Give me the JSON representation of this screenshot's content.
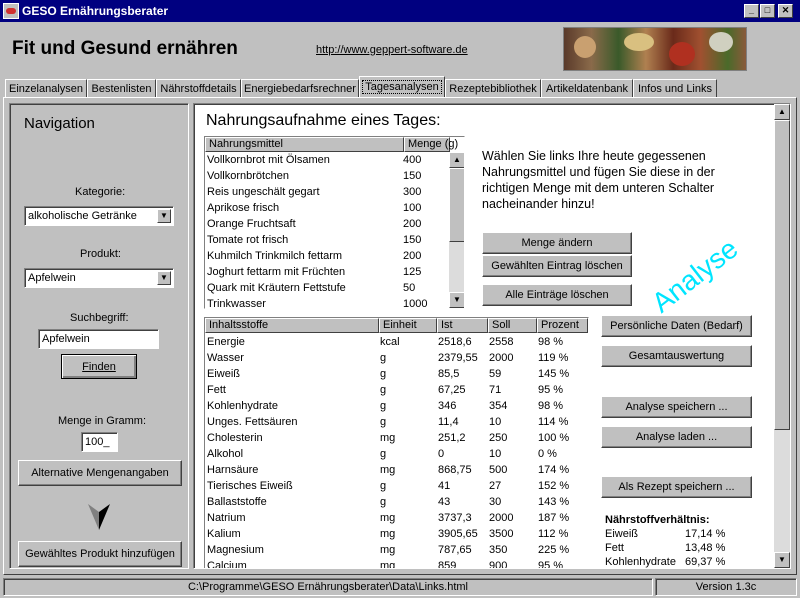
{
  "window": {
    "title": "GESO Ernährungsberater",
    "min": "_",
    "max": "□",
    "close": "✕"
  },
  "header": {
    "title": "Fit und Gesund ernähren",
    "link": "http://www.geppert-software.de"
  },
  "tabs": [
    {
      "label": "Einzelanalysen"
    },
    {
      "label": "Bestenlisten"
    },
    {
      "label": "Nährstoffdetails"
    },
    {
      "label": "Energiebedarfsrechner"
    },
    {
      "label": "Tagesanalysen"
    },
    {
      "label": "Rezeptebibliothek"
    },
    {
      "label": "Artikeldatenbank"
    },
    {
      "label": "Infos und Links"
    }
  ],
  "nav": {
    "title": "Navigation",
    "kategorie_label": "Kategorie:",
    "kategorie_value": "alkoholische Getränke",
    "produkt_label": "Produkt:",
    "produkt_value": "Apfelwein",
    "such_label": "Suchbegriff:",
    "such_value": "Apfelwein",
    "finden": "Finden",
    "menge_label": "Menge in Gramm:",
    "menge_value": "100_",
    "alt_button": "Alternative Mengenangaben",
    "add_button": "Gewähltes Produkt hinzufügen"
  },
  "main": {
    "title": "Nahrungsaufnahme eines Tages:",
    "instructions": "Wählen Sie links Ihre heute gegessenen Nahrungsmittel und fügen Sie diese in der richtigen Menge mit dem unteren Schalter nacheinander hinzu!",
    "analyse": "Analyse",
    "btn_menge": "Menge ändern",
    "btn_loeschen": "Gewählten Eintrag löschen",
    "btn_alle": "Alle Einträge löschen",
    "btn_pers": "Persönliche Daten (Bedarf)",
    "btn_gesamt": "Gesamtauswertung",
    "btn_speichern": "Analyse speichern ...",
    "btn_laden": "Analyse laden ...",
    "btn_rezept": "Als Rezept speichern ..."
  },
  "food_table": {
    "headers": [
      "Nahrungsmittel",
      "Menge (g)"
    ],
    "rows": [
      [
        "Vollkornbrot mit Ölsamen",
        "400"
      ],
      [
        "Vollkornbrötchen",
        "150"
      ],
      [
        "Reis ungeschält gegart",
        "300"
      ],
      [
        "Aprikose frisch",
        "100"
      ],
      [
        "Orange Fruchtsaft",
        "200"
      ],
      [
        "Tomate rot frisch",
        "150"
      ],
      [
        "Kuhmilch Trinkmilch fettarm",
        "200"
      ],
      [
        "Joghurt fettarm mit Früchten",
        "125"
      ],
      [
        "Quark mit Kräutern Fettstufe",
        "50"
      ],
      [
        "Trinkwasser",
        "1000"
      ]
    ]
  },
  "nutrient_table": {
    "headers": [
      "Inhaltsstoffe",
      "Einheit",
      "Ist",
      "Soll",
      "Prozent"
    ],
    "rows": [
      [
        "Energie",
        "kcal",
        "2518,6",
        "2558",
        "98 %"
      ],
      [
        "Wasser",
        "g",
        "2379,55",
        "2000",
        "119 %"
      ],
      [
        "Eiweiß",
        "g",
        "85,5",
        "59",
        "145 %"
      ],
      [
        "Fett",
        "g",
        "67,25",
        "71",
        "95 %"
      ],
      [
        "Kohlenhydrate",
        "g",
        "346",
        "354",
        "98 %"
      ],
      [
        "Unges. Fettsäuren",
        "g",
        "11,4",
        "10",
        "114 %"
      ],
      [
        "Cholesterin",
        "mg",
        "251,2",
        "250",
        "100 %"
      ],
      [
        "Alkohol",
        "g",
        "0",
        "10",
        "0 %"
      ],
      [
        "Harnsäure",
        "mg",
        "868,75",
        "500",
        "174 %"
      ],
      [
        "Tierisches Eiweiß",
        "g",
        "41",
        "27",
        "152 %"
      ],
      [
        "Ballaststoffe",
        "g",
        "43",
        "30",
        "143 %"
      ],
      [
        "Natrium",
        "mg",
        "3737,3",
        "2000",
        "187 %"
      ],
      [
        "Kalium",
        "mg",
        "3905,65",
        "3500",
        "112 %"
      ],
      [
        "Magnesium",
        "mg",
        "787,65",
        "350",
        "225 %"
      ],
      [
        "Calcium",
        "mg",
        "859",
        "900",
        "95 %"
      ]
    ]
  },
  "ratio": {
    "title": "Nährstoffverhältnis:",
    "rows": [
      [
        "Eiweiß",
        "17,14 %"
      ],
      [
        "Fett",
        "13,48 %"
      ],
      [
        "Kohlenhydrate",
        "69,37 %"
      ]
    ]
  },
  "status": {
    "path": "C:\\Programme\\GESO Ernährungsberater\\Data\\Links.html",
    "version": "Version 1.3c"
  },
  "colors": {
    "titlebar": "#000080",
    "analyse": "#00e5ff",
    "link": "#000080"
  }
}
